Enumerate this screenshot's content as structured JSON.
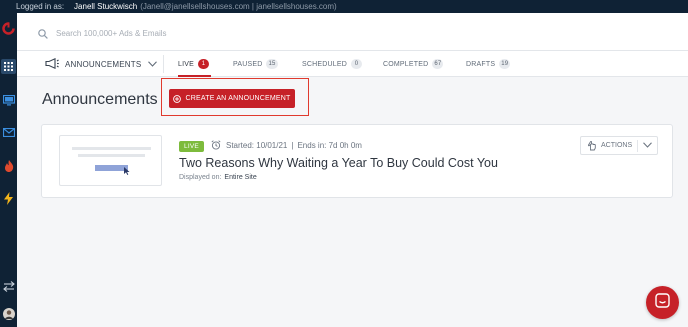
{
  "topbar": {
    "logged_in_label": "Logged in as:",
    "user_name": "Janell Stuckwisch",
    "user_email": "(Janell@janellsellshouses.com | janellsellshouses.com)"
  },
  "sidebar": {
    "items": [
      "logo-icon",
      "apps-grid-icon",
      "monitor-icon",
      "mail-icon",
      "fire-icon",
      "bolt-icon",
      "swap-arrows-icon",
      "user-avatar"
    ]
  },
  "search": {
    "placeholder": "Search 100,000+ Ads & Emails",
    "value": ""
  },
  "section_selector": {
    "label": "ANNOUNCEMENTS"
  },
  "tabs": [
    {
      "label": "LIVE",
      "count": "1",
      "active": true
    },
    {
      "label": "PAUSED",
      "count": "15",
      "active": false
    },
    {
      "label": "SCHEDULED",
      "count": "0",
      "active": false
    },
    {
      "label": "COMPLETED",
      "count": "67",
      "active": false
    },
    {
      "label": "DRAFTS",
      "count": "19",
      "active": false
    }
  ],
  "page": {
    "title": "Announcements",
    "create_button": "CREATE AN ANNOUNCEMENT"
  },
  "announcement": {
    "status": "LIVE",
    "started": "Started: 10/01/21",
    "separator": "|",
    "ends": "Ends in: 7d 0h 0m",
    "title": "Two Reasons Why Waiting a Year To Buy Could Cost You",
    "displayed_label": "Displayed on:",
    "displayed_value": "Entire Site",
    "actions_label": "ACTIONS"
  },
  "colors": {
    "accent": "#c62128",
    "sidebar": "#0f2235",
    "live": "#7dbb3c",
    "highlight": "#e03a2e"
  }
}
